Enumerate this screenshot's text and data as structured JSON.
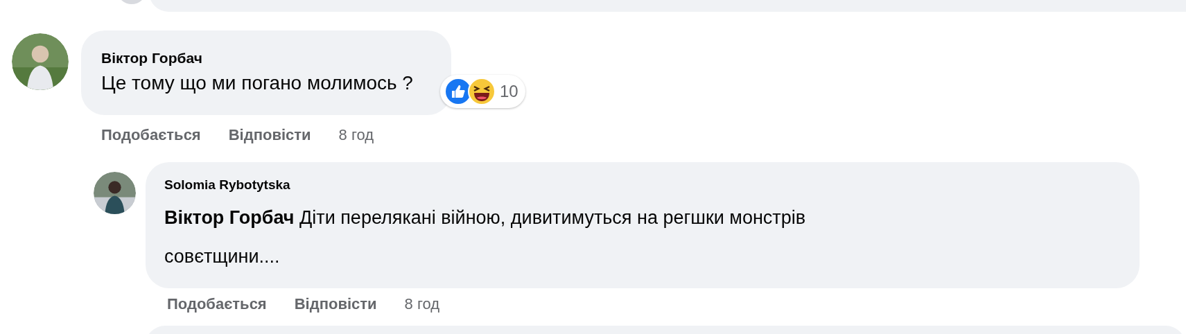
{
  "comments": [
    {
      "author": "Віктор Горбач",
      "text": "Це тому що ми погано молимось ?",
      "reactions": {
        "count": "10"
      },
      "actions": [
        "Подобається",
        "Відповісти"
      ],
      "time": "8 год",
      "replies": [
        {
          "author": "Solomia Rybotytska",
          "text": "**Віктор Горбач** Діти перелякані війною, дивитимуться на регшки монстрів совєтщини....",
          "actions": [
            "Подобається",
            "Відповісти"
          ],
          "time": "8 год"
        }
      ]
    }
  ]
}
